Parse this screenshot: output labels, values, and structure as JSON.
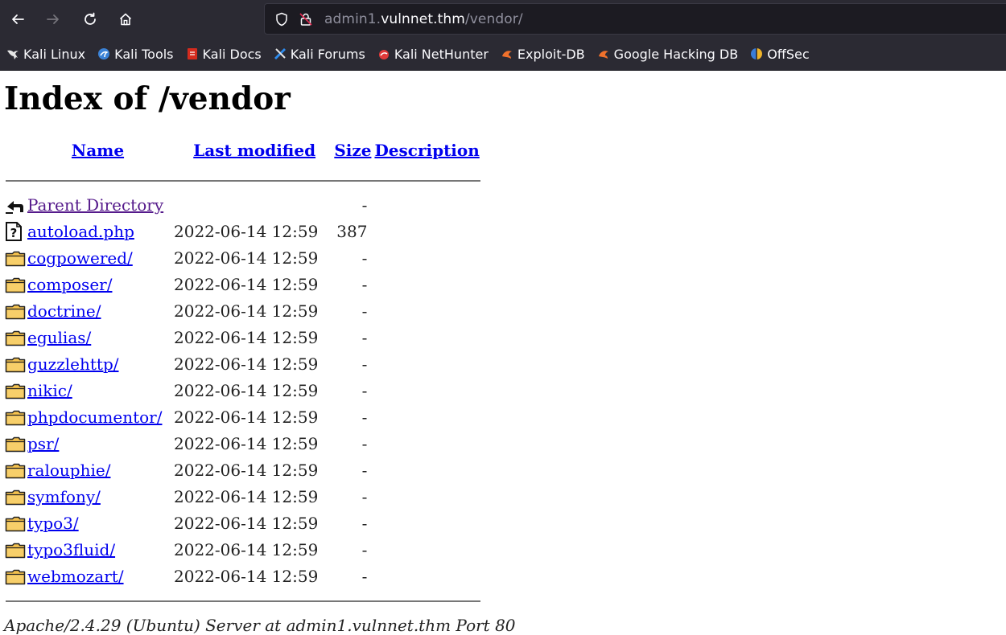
{
  "browser": {
    "url_prefix": "admin1.",
    "url_host": "vulnnet.thm",
    "url_path": "/vendor/"
  },
  "bookmarks": [
    {
      "label": "Kali Linux",
      "icon": "kali-dragon-icon"
    },
    {
      "label": "Kali Tools",
      "icon": "kali-tools-icon"
    },
    {
      "label": "Kali Docs",
      "icon": "kali-docs-icon"
    },
    {
      "label": "Kali Forums",
      "icon": "kali-forums-icon"
    },
    {
      "label": "Kali NetHunter",
      "icon": "kali-nethunter-icon"
    },
    {
      "label": "Exploit-DB",
      "icon": "exploit-db-icon"
    },
    {
      "label": "Google Hacking DB",
      "icon": "ghdb-icon"
    },
    {
      "label": "OffSec",
      "icon": "offsec-icon"
    }
  ],
  "page": {
    "title": "Index of /vendor",
    "columns": {
      "name": "Name",
      "modified": "Last modified",
      "size": "Size",
      "description": "Description"
    },
    "parent": {
      "name": "Parent Directory",
      "size": "-"
    },
    "entries": [
      {
        "name": "autoload.php",
        "modified": "2022-06-14 12:59",
        "size": "387",
        "type": "file"
      },
      {
        "name": "cogpowered/",
        "modified": "2022-06-14 12:59",
        "size": "-",
        "type": "folder"
      },
      {
        "name": "composer/",
        "modified": "2022-06-14 12:59",
        "size": "-",
        "type": "folder"
      },
      {
        "name": "doctrine/",
        "modified": "2022-06-14 12:59",
        "size": "-",
        "type": "folder"
      },
      {
        "name": "egulias/",
        "modified": "2022-06-14 12:59",
        "size": "-",
        "type": "folder"
      },
      {
        "name": "guzzlehttp/",
        "modified": "2022-06-14 12:59",
        "size": "-",
        "type": "folder"
      },
      {
        "name": "nikic/",
        "modified": "2022-06-14 12:59",
        "size": "-",
        "type": "folder"
      },
      {
        "name": "phpdocumentor/",
        "modified": "2022-06-14 12:59",
        "size": "-",
        "type": "folder"
      },
      {
        "name": "psr/",
        "modified": "2022-06-14 12:59",
        "size": "-",
        "type": "folder"
      },
      {
        "name": "ralouphie/",
        "modified": "2022-06-14 12:59",
        "size": "-",
        "type": "folder"
      },
      {
        "name": "symfony/",
        "modified": "2022-06-14 12:59",
        "size": "-",
        "type": "folder"
      },
      {
        "name": "typo3/",
        "modified": "2022-06-14 12:59",
        "size": "-",
        "type": "folder"
      },
      {
        "name": "typo3fluid/",
        "modified": "2022-06-14 12:59",
        "size": "-",
        "type": "folder"
      },
      {
        "name": "webmozart/",
        "modified": "2022-06-14 12:59",
        "size": "-",
        "type": "folder"
      }
    ],
    "footer": "Apache/2.4.29 (Ubuntu) Server at admin1.vulnnet.thm Port 80"
  }
}
